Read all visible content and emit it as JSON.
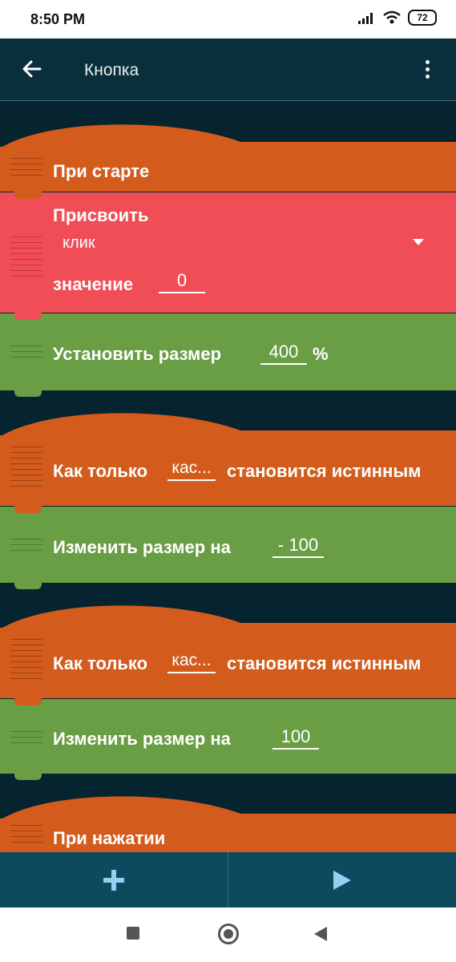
{
  "status": {
    "time": "8:50 PM",
    "battery": "72"
  },
  "appbar": {
    "title": "Кнопка",
    "back_icon": "arrow-left-icon",
    "menu_icon": "more-vert-icon"
  },
  "blocks": {
    "on_start": {
      "label": "При старте"
    },
    "assign": {
      "label": "Присвоить",
      "variable": "клик",
      "value_label": "значение",
      "value": "0"
    },
    "set_size": {
      "label": "Установить размер",
      "value": "400",
      "unit": "%"
    },
    "when_true_1": {
      "label_before": "Как только",
      "condition": "кас...",
      "label_after": "становится истинным"
    },
    "change_size_1": {
      "label": "Изменить размер на",
      "value": "- 100"
    },
    "when_true_2": {
      "label_before": "Как только",
      "condition": "кас...",
      "label_after": "становится истинным"
    },
    "change_size_2": {
      "label": "Изменить размер на",
      "value": "100"
    },
    "on_press": {
      "label": "При нажатии"
    }
  },
  "toolbar": {
    "add_icon": "plus-icon",
    "play_icon": "play-icon"
  },
  "colors": {
    "event": "#d35c1d",
    "variable": "#f04d57",
    "action": "#6a9e45",
    "background": "#062430"
  }
}
